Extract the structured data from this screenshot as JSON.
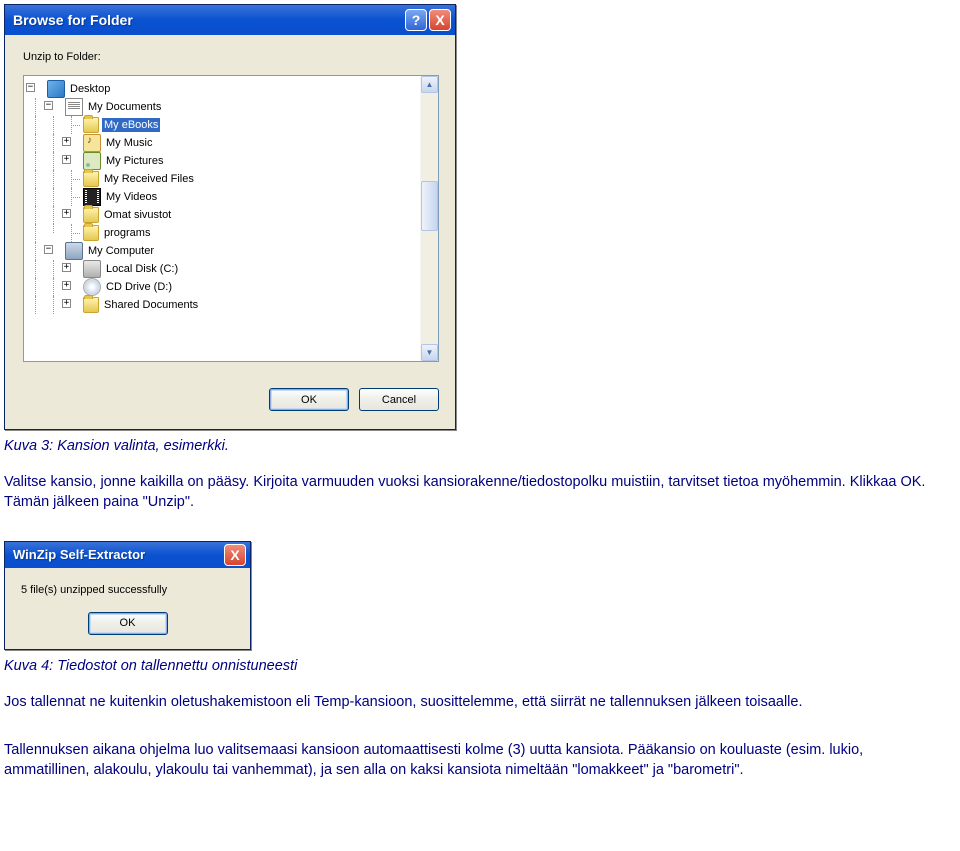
{
  "browse_dialog": {
    "title": "Browse for Folder",
    "help": "?",
    "close": "X",
    "label": "Unzip to Folder:",
    "tree": {
      "desktop": "Desktop",
      "my_documents": "My Documents",
      "my_ebooks": "My eBooks",
      "my_music": "My Music",
      "my_pictures": "My Pictures",
      "my_received_files": "My Received Files",
      "my_videos": "My Videos",
      "omat_sivustot": "Omat sivustot",
      "programs": "programs",
      "my_computer": "My Computer",
      "local_disk": "Local Disk (C:)",
      "cd_drive": "CD Drive (D:)",
      "shared_documents": "Shared Documents"
    },
    "ok": "OK",
    "cancel": "Cancel"
  },
  "caption1": "Kuva 3: Kansion valinta, esimerkki.",
  "para1": "Valitse kansio, jonne kaikilla on pääsy. Kirjoita varmuuden vuoksi kansiorakenne/tiedostopolku muistiin, tarvitset tietoa myöhemmin. Klikkaa OK. Tämän jälkeen paina \"Unzip\".",
  "extractor_dialog": {
    "title": "WinZip Self-Extractor",
    "close": "X",
    "message": "5 file(s) unzipped successfully",
    "ok": "OK"
  },
  "caption2": "Kuva 4: Tiedostot on tallennettu onnistuneesti",
  "para2": "Jos tallennat ne kuitenkin oletushakemistoon eli Temp-kansioon, suosittelemme, että siirrät ne tallennuksen jälkeen toisaalle.",
  "para3": "Tallennuksen aikana ohjelma luo valitsemaasi kansioon automaattisesti kolme (3) uutta kansiota. Pääkansio on kouluaste (esim. lukio, ammatillinen, alakoulu, ylakoulu tai vanhemmat), ja sen alla on kaksi kansiota nimeltään \"lomakkeet\" ja \"barometri\"."
}
